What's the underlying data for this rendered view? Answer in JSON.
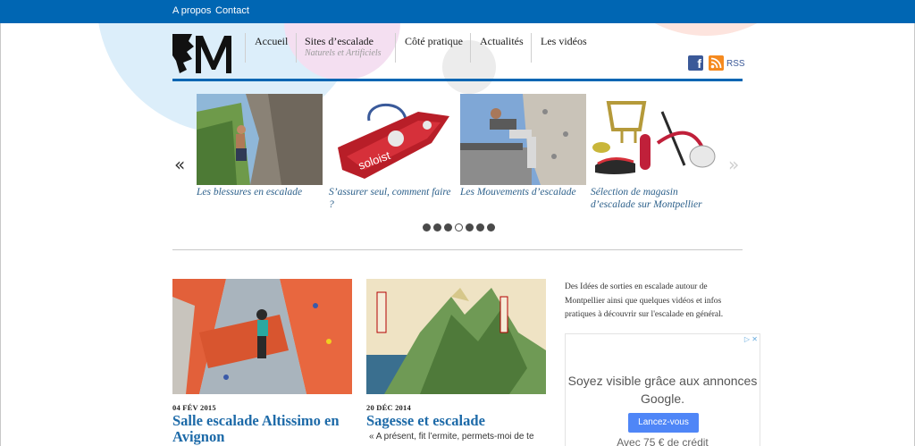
{
  "topbar": {
    "links": [
      "A propos",
      "Contact"
    ]
  },
  "nav": {
    "items": [
      "Accueil",
      "Sites d’escalade",
      "Côté pratique",
      "Actualités",
      "Les vidéos"
    ],
    "sites_sub": "Naturels et Artificiels"
  },
  "social": {
    "rss_label": "RSS"
  },
  "slider": {
    "prev": "«",
    "next": "»",
    "slides": [
      {
        "caption": "Les blessures en escalade"
      },
      {
        "caption": "S’assurer seul, comment faire ?"
      },
      {
        "caption": "Les Mouvements d’escalade"
      },
      {
        "caption": "Sélection de magasin d’escalade sur Montpellier"
      }
    ],
    "dot_count": 7,
    "active_dot": 4
  },
  "articles": [
    {
      "date": "04 FÉV 2015",
      "title": "Salle escalade Altissimo en Avignon"
    },
    {
      "date": "20 DÉC 2014",
      "title": "Sagesse et escalade",
      "excerpt": "« A présent, fit l’ermite, permets-moi de te"
    }
  ],
  "sidebar": {
    "text": "Des Idées de sorties en escalade autour de Montpellier ainsi que quelques vidéos et infos pratiques à découvrir sur l'escalade en général.",
    "ad": {
      "headline": "Soyez visible grâce aux annonces Google.",
      "button": "Lancez-vous",
      "footer": "Avec 75 € de crédit"
    }
  },
  "colors": {
    "brand_blue": "#0066b3",
    "link_blue": "#1d6aa8"
  }
}
